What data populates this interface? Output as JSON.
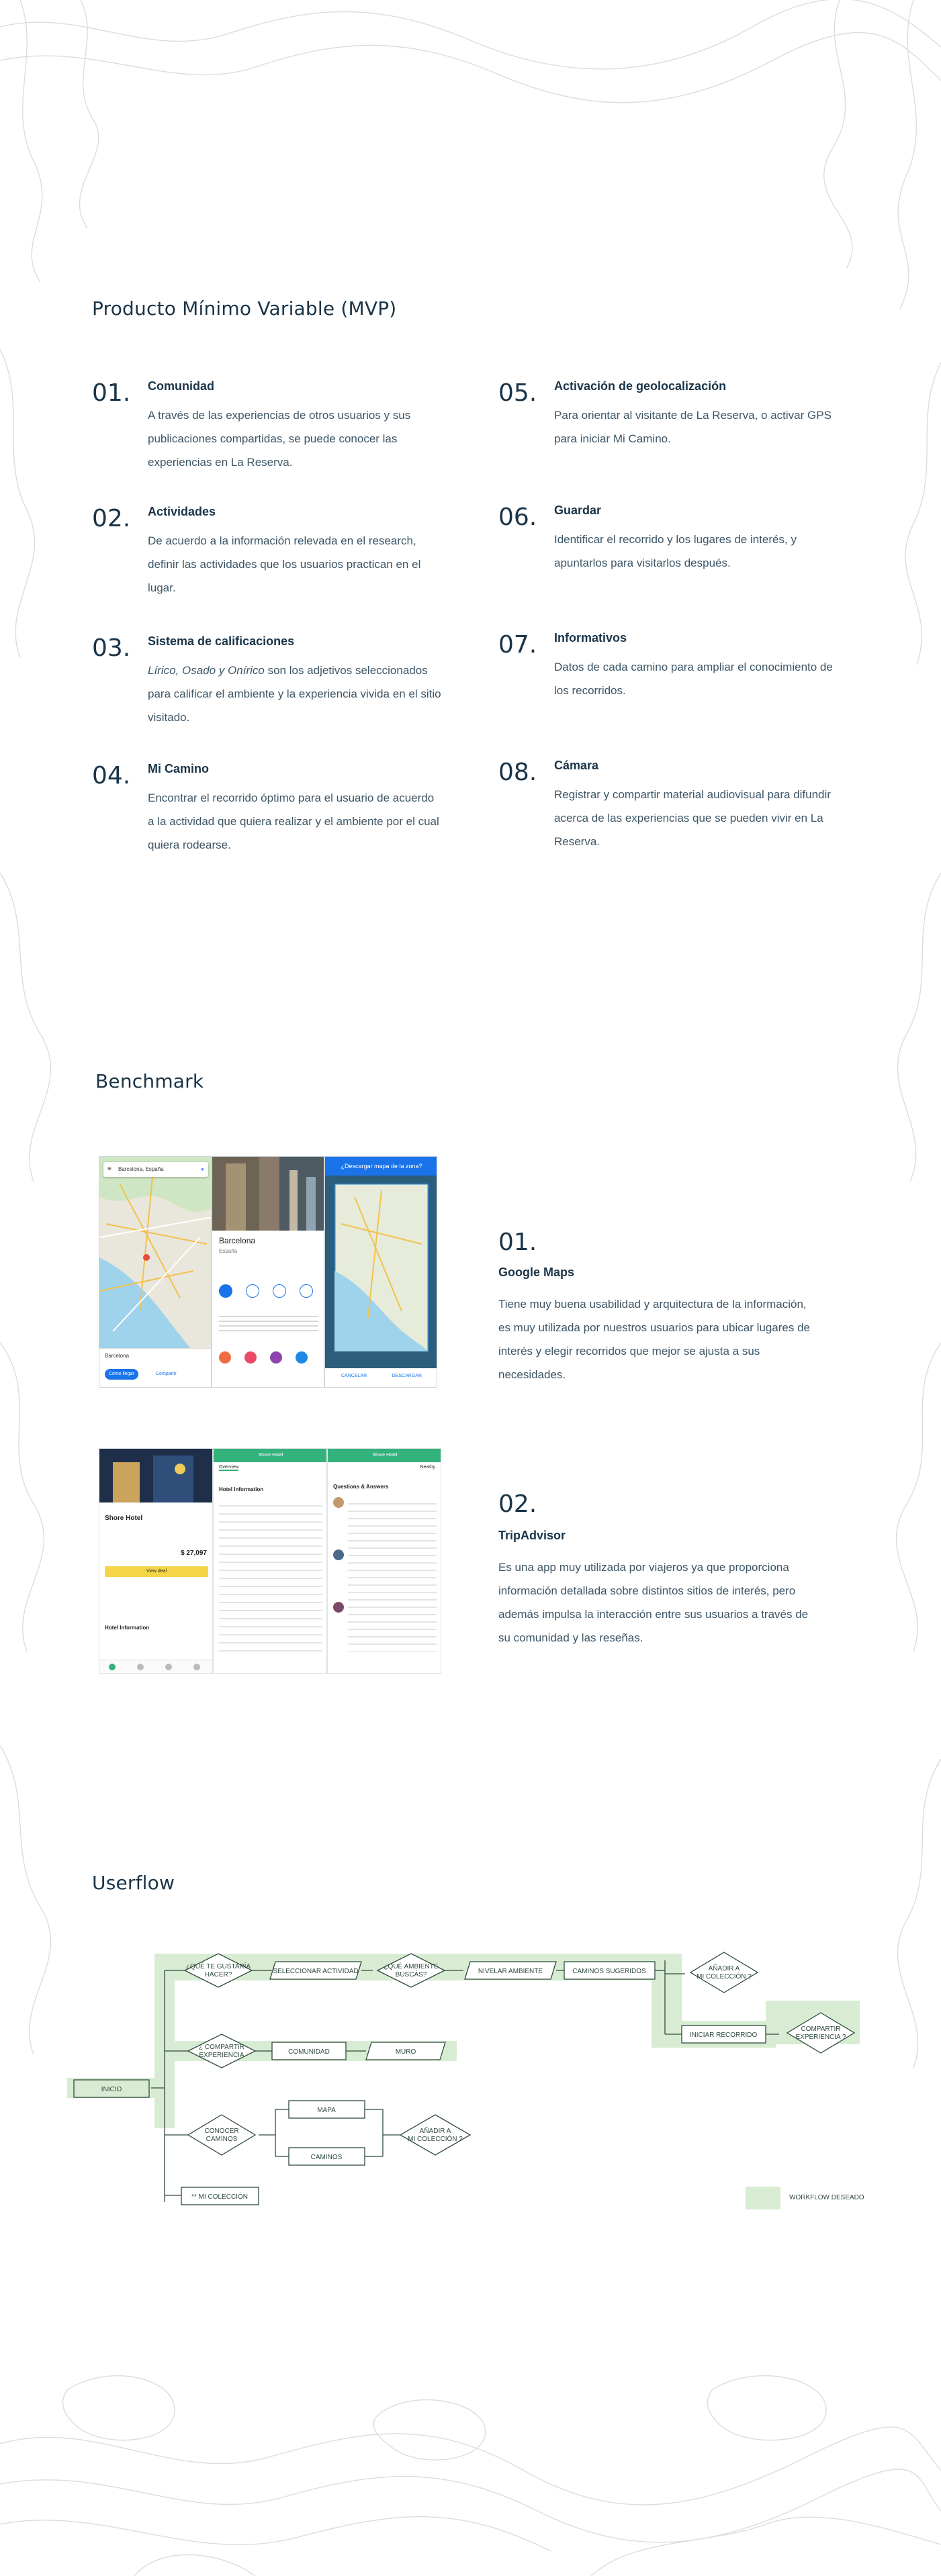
{
  "mvp": {
    "heading": "Producto Mínimo Variable (MVP)",
    "items": [
      {
        "num": "01.",
        "title": "Comunidad",
        "desc": "A través de las experiencias de otros usuarios y sus publicaciones compartidas, se puede conocer las experiencias en La Reserva."
      },
      {
        "num": "02.",
        "title": "Actividades",
        "desc": "De acuerdo a la información relevada en el research, definir las actividades que los usuarios practican en el lugar."
      },
      {
        "num": "03.",
        "title": "Sistema de calificaciones",
        "desc_italic": "Lírico, Osado y Onírico",
        "desc": " son los adjetivos seleccionados para calificar el ambiente y la experiencia vivida en el sitio visitado."
      },
      {
        "num": "04.",
        "title": "Mi Camino",
        "desc": "Encontrar el recorrido óptimo para el usuario de acuerdo a la actividad que quiera realizar y el ambiente por el cual quiera rodearse."
      },
      {
        "num": "05.",
        "title": "Activación de geolocalización",
        "desc": "Para orientar al visitante de La Reserva, o activar GPS para iniciar Mi Camino."
      },
      {
        "num": "06.",
        "title": "Guardar",
        "desc": "Identificar el recorrido y los lugares de interés, y apuntarlos para visitarlos después."
      },
      {
        "num": "07.",
        "title": "Informativos",
        "desc": "Datos de cada camino para ampliar el conocimiento de los recorridos."
      },
      {
        "num": "08.",
        "title": "Cámara",
        "desc": "Registrar y compartir material audiovisual para difundir acerca de las experiencias que se pueden vivir en La Reserva."
      }
    ]
  },
  "benchmark": {
    "heading": "Benchmark",
    "items": [
      {
        "num": "01.",
        "title": "Google Maps",
        "desc": "Tiene muy buena usabilidad y arquitectura de la información, es  muy utilizada por nuestros usuarios para ubicar lugares de interés y elegir recorridos que mejor se ajusta a sus necesidades."
      },
      {
        "num": "02.",
        "title": "TripAdvisor",
        "desc": "Es una app muy utilizada por viajeros ya que proporciona información detallada sobre distintos sitios de interés, pero además impulsa la interacción entre sus usuarios a través de su comunidad y las reseñas."
      }
    ],
    "gmaps": {
      "search": "Barcelona, España",
      "place_title": "Barcelona",
      "place_sub": "España",
      "banner": "¿Descargar mapa de la zona?",
      "btn_cancel": "CANCELAR",
      "btn_download": "DESCARGAR",
      "chip_directions": "Cómo llegar",
      "chip_share": "Compartir"
    },
    "tripadvisor": {
      "hotel_name": "Shore Hotel",
      "tab_overview": "Overview",
      "tab_nearby": "Nearby",
      "hotel_info": "Hotel Information",
      "qa_title": "Questions & Answers",
      "price": "$ 27,097",
      "view_deal": "View deal",
      "header_hotel": "Shore Hotel"
    }
  },
  "userflow": {
    "heading": "Userflow",
    "nodes": {
      "inicio": "INICIO",
      "que_hacer_1": "¿QUÉ TE GUSTARÍA",
      "que_hacer_2": "HACER?",
      "seleccionar": "SELECCIONAR ACTIVIDAD",
      "ambiente_1": "¿QUÉ AMBIENTE",
      "ambiente_2": "BUSCÁS?",
      "nivelar": "NIVELAR AMBIENTE",
      "caminos_sug": "CAMINOS SUGERIDOS",
      "anadir1_1": "AÑADIR A",
      "anadir1_2": "MI COLECCIÓN ?",
      "iniciar": "INICIAR RECORRIDO",
      "compartir_exp_1": "COMPARTIR",
      "compartir_exp_2": "EXPERIENCIA ?",
      "compartir_1": "¿ COMPARTIR",
      "compartir_2": "EXPERIENCIA",
      "comunidad": "COMUNIDAD",
      "muro": "MURO",
      "conocer_1": "CONOCER",
      "conocer_2": "CAMINOS",
      "mapa": "MAPA",
      "caminos": "CAMINOS",
      "anadir2_1": "AÑADIR A",
      "anadir2_2": "MI COLECCIÓN ?",
      "mi_coleccion": "** MI COLECCIÓN"
    },
    "legend": "WORKFLOW DESEADO",
    "colors": {
      "highlight": "#d8ecd3",
      "stroke": "#2f4a3c"
    }
  }
}
